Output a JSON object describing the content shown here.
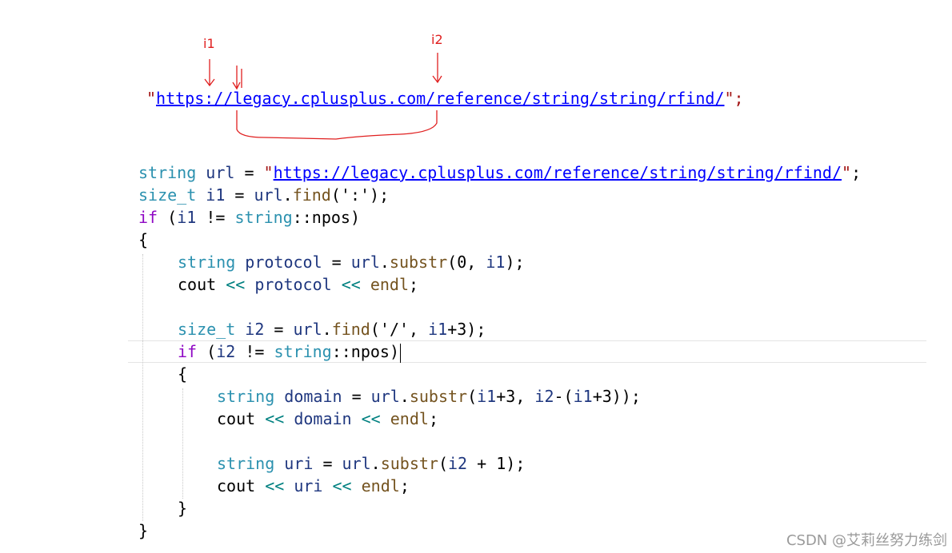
{
  "annotations": {
    "label_i1": "i1",
    "label_i2": "i2",
    "color": "#e02020"
  },
  "top_string": {
    "open_quote": "\"",
    "url": "https://legacy.cplusplus.com/reference/string/string/rfind/",
    "close": "\";"
  },
  "code": {
    "l1": {
      "type": "string",
      "var": "url",
      "eq": " = ",
      "open": "\"",
      "url": "https://legacy.cplusplus.com/reference/string/string/rfind/",
      "close": "\"",
      "semi": ";"
    },
    "l2": {
      "type": "size_t",
      "var": "i1",
      "eq": " = ",
      "obj": "url",
      "dot": ".",
      "fn": "find",
      "args": "(':');"
    },
    "l3": {
      "kw": "if",
      "open": " (",
      "var": "i1",
      "op": " != ",
      "type": "string",
      "rest": "::npos)"
    },
    "l4": {
      "brace": "{"
    },
    "l5": {
      "type": "string",
      "var": "protocol",
      "eq": " = ",
      "obj": "url",
      "dot": ".",
      "fn": "substr",
      "a1": "(0, ",
      "a2": "i1",
      "a3": ");"
    },
    "l6": {
      "cout": "cout",
      "ins1": " << ",
      "var": "protocol",
      "ins2": " << ",
      "endl": "endl",
      "semi": ";"
    },
    "l7": {
      "type": "size_t",
      "var": "i2",
      "eq": " = ",
      "obj": "url",
      "dot": ".",
      "fn": "find",
      "a1": "('/', ",
      "a2": "i1",
      "a3": "+3);"
    },
    "l8": {
      "kw": "if",
      "open": " (",
      "var": "i2",
      "op": " != ",
      "type": "string",
      "rest": "::npos)"
    },
    "l9": {
      "brace": "{"
    },
    "l10": {
      "type": "string",
      "var": "domain",
      "eq": " = ",
      "obj": "url",
      "dot": ".",
      "fn": "substr",
      "a1": "(",
      "a2": "i1",
      "a3": "+3, ",
      "a4": "i2",
      "a5": "-(",
      "a6": "i1",
      "a7": "+3));"
    },
    "l11": {
      "cout": "cout",
      "ins1": " << ",
      "var": "domain",
      "ins2": " << ",
      "endl": "endl",
      "semi": ";"
    },
    "l12": {
      "type": "string",
      "var": "uri",
      "eq": " = ",
      "obj": "url",
      "dot": ".",
      "fn": "substr",
      "a1": "(",
      "a2": "i2",
      "a3": " + 1);"
    },
    "l13": {
      "cout": "cout",
      "ins1": " << ",
      "var": "uri",
      "ins2": " << ",
      "endl": "endl",
      "semi": ";"
    },
    "l14": {
      "brace": "}"
    },
    "l15": {
      "brace": "}"
    }
  },
  "watermark": "CSDN @艾莉丝努力练剑"
}
